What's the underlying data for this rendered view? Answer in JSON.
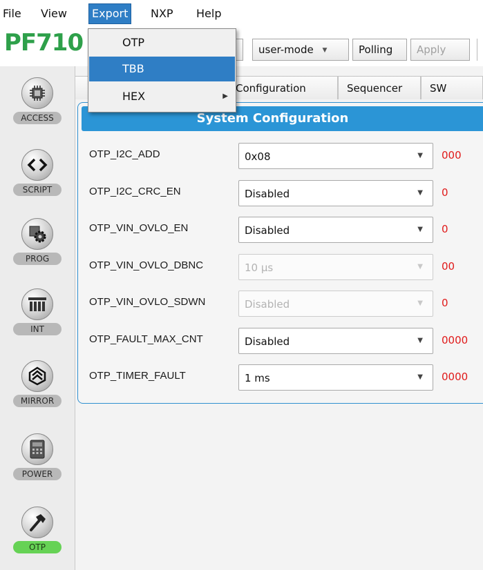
{
  "menubar": {
    "items": [
      "File",
      "View",
      "Export",
      "NXP",
      "Help"
    ],
    "active": "Export"
  },
  "app": {
    "title": "PF710"
  },
  "toolbar": {
    "mode_select": "user-mode",
    "polling_label": "Polling",
    "apply_label": "Apply"
  },
  "export_menu": {
    "items": [
      {
        "label": "OTP"
      },
      {
        "label": "TBB",
        "highlighted": true
      },
      {
        "label": "HEX",
        "has_submenu": true
      }
    ]
  },
  "tabs": [
    "are Configuration",
    "Sequencer",
    "SW"
  ],
  "sidebar": {
    "items": [
      {
        "label": "ACCESS",
        "icon": "chip-icon"
      },
      {
        "label": "SCRIPT",
        "icon": "code-brackets-icon"
      },
      {
        "label": "PROG",
        "icon": "gear-chip-icon"
      },
      {
        "label": "INT",
        "icon": "register-bars-icon"
      },
      {
        "label": "MIRROR",
        "icon": "mirror-icon"
      },
      {
        "label": "POWER",
        "icon": "calculator-icon"
      },
      {
        "label": "OTP",
        "icon": "hammer-icon",
        "active": true
      }
    ]
  },
  "panel": {
    "title": "System Configuration",
    "rows": [
      {
        "label": "OTP_I2C_ADD",
        "value": "0x08",
        "code": "000",
        "disabled": false
      },
      {
        "label": "OTP_I2C_CRC_EN",
        "value": "Disabled",
        "code": "0",
        "disabled": false
      },
      {
        "label": "OTP_VIN_OVLO_EN",
        "value": "Disabled",
        "code": "0",
        "disabled": false
      },
      {
        "label": "OTP_VIN_OVLO_DBNC",
        "value": "10 µs",
        "code": "00",
        "disabled": true
      },
      {
        "label": "OTP_VIN_OVLO_SDWN",
        "value": "Disabled",
        "code": "0",
        "disabled": true
      },
      {
        "label": "OTP_FAULT_MAX_CNT",
        "value": "Disabled",
        "code": "0000",
        "disabled": false
      },
      {
        "label": "OTP_TIMER_FAULT",
        "value": "1 ms",
        "code": "0000",
        "disabled": false
      }
    ]
  },
  "colors": {
    "accent_blue": "#2b95d6",
    "menu_highlight": "#2f7ec5",
    "title_green": "#2ea04a",
    "active_badge": "#66d255",
    "code_red": "#e01a1a"
  }
}
